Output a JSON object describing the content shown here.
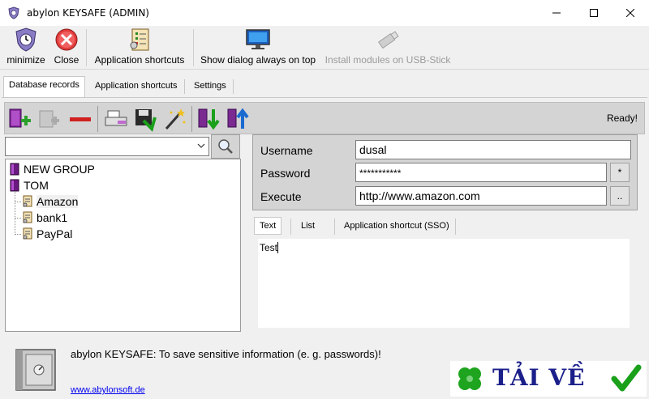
{
  "window": {
    "title": "abylon KEYSAFE (ADMIN)",
    "controls": {
      "minimize": "—",
      "maximize": "☐",
      "close": "✕"
    }
  },
  "toolbar": {
    "buttons": [
      {
        "label": "minimize",
        "icon": "clock-shield-icon",
        "enabled": true
      },
      {
        "label": "Close",
        "icon": "close-circle-icon",
        "enabled": true
      },
      {
        "label": "Application shortcuts",
        "icon": "list-checklist-icon",
        "enabled": true
      },
      {
        "label": "Show dialog always on top",
        "icon": "monitor-icon",
        "enabled": true
      },
      {
        "label": "Install modules on USB-Stick",
        "icon": "usb-stick-icon",
        "enabled": false
      }
    ]
  },
  "tabs": [
    "Database records",
    "Application shortcuts",
    "Settings"
  ],
  "active_tab": "Database records",
  "records_toolbar": {
    "icons": [
      "add-group-icon",
      "copy-entry-icon",
      "remove-icon",
      "print-icon",
      "save-icon",
      "wizard-icon",
      "move-down-icon",
      "move-up-icon"
    ],
    "status": "Ready!"
  },
  "search": {
    "value": "",
    "icon": "search-icon"
  },
  "tree": {
    "groups": [
      {
        "label": "NEW GROUP",
        "icon": "book-icon",
        "children": []
      },
      {
        "label": "TOM",
        "icon": "book-icon",
        "children": [
          "Amazon",
          "bank1",
          "PayPal"
        ]
      }
    ],
    "selected": "Amazon"
  },
  "form": {
    "username_label": "Username",
    "username": "dusal",
    "password_label": "Password",
    "password": "***********",
    "password_btn": "*",
    "execute_label": "Execute",
    "execute": "http://www.amazon.com",
    "execute_btn": ".."
  },
  "inner_tabs": [
    "Text",
    "List",
    "Application shortcut (SSO)"
  ],
  "inner_active": "Text",
  "notes_text": "Test",
  "footer": {
    "info": "abylon KEYSAFE: To save sensitive information (e. g. passwords)!",
    "link": "www.abylonsoft.de"
  },
  "banner": {
    "text": "TẢI VỀ"
  },
  "colors": {
    "accent": "#0000ee",
    "banner_text": "#1a1f8a",
    "toolbar_bg": "#d4d4d4"
  }
}
